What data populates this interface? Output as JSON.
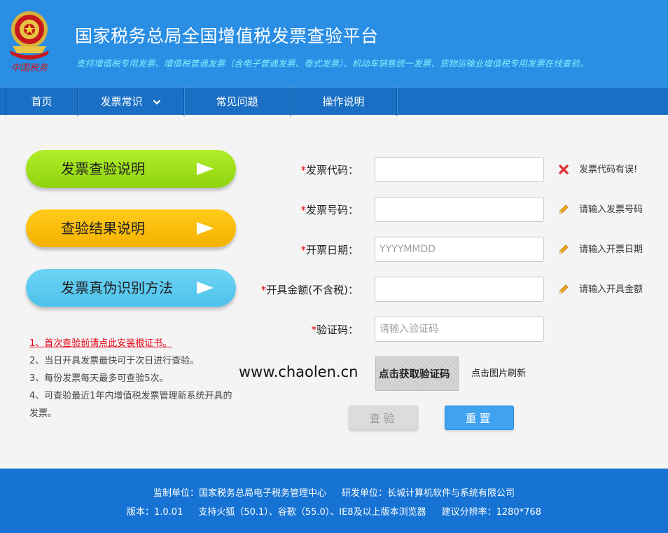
{
  "header": {
    "title": "国家税务总局全国增值税发票查验平台",
    "subtitle": "支持增值税专用发票、增值税普通发票（含电子普通发票、卷式发票）、机动车销售统一发票、货物运输业增值税专用发票在线查验。",
    "logo_text": "中国税务",
    "colors": {
      "header_bg": "#2a8ee4",
      "nav_bg": "#1a6fc4",
      "subtitle": "#7ff0ff"
    }
  },
  "nav": {
    "items": [
      {
        "label": "首页"
      },
      {
        "label": "发票常识",
        "icon": "chevron-down-icon"
      },
      {
        "label": "常见问题"
      },
      {
        "label": "操作说明"
      }
    ]
  },
  "side_buttons": [
    {
      "label": "发票查验说明",
      "color": "#9fe01c",
      "icon": "play-arrow-icon"
    },
    {
      "label": "查验结果说明",
      "color": "#fbbd07",
      "icon": "play-arrow-icon"
    },
    {
      "label": "发票真伪识别方法",
      "color": "#5ccbf0",
      "icon": "play-arrow-icon"
    }
  ],
  "notes": [
    "1、首次查验前请点此安装根证书。",
    "2、当日开具发票最快可于次日进行查验。",
    "3、每份发票每天最多可查验5次。",
    "4、可查验最近1年内增值税发票管理新系统开具的发票。"
  ],
  "form": {
    "required_mark": "*",
    "fields": [
      {
        "label": "发票代码：",
        "value": "",
        "placeholder": "",
        "hint": "发票代码有误!",
        "hint_icon": "error-x-icon"
      },
      {
        "label": "发票号码：",
        "value": "",
        "placeholder": "",
        "hint": "请输入发票号码",
        "hint_icon": "pencil-icon"
      },
      {
        "label": "开票日期：",
        "value": "",
        "placeholder": "YYYYMMDD",
        "hint": "请输入开票日期",
        "hint_icon": "pencil-icon"
      },
      {
        "label": "开具金额(不含税)：",
        "value": "",
        "placeholder": "",
        "hint": "请输入开具金额",
        "hint_icon": "pencil-icon"
      },
      {
        "label": "验证码：",
        "value": "",
        "placeholder": "请输入验证码"
      }
    ],
    "captcha_text": "点击获取验证码",
    "captcha_refresh": "点击图片刷新",
    "watermark": "www.chaolen.cn",
    "check_button": "查验",
    "reset_button": "重置"
  },
  "footer": {
    "supervisor": "监制单位：国家税务总局电子税务管理中心",
    "developer": "研发单位：长城计算机软件与系统有限公司",
    "version": "版本：1.0.01",
    "browsers": "支持火狐（50.1）、谷歌（55.0）、IE8及以上版本浏览器",
    "resolution": "建议分辨率：1280*768"
  }
}
